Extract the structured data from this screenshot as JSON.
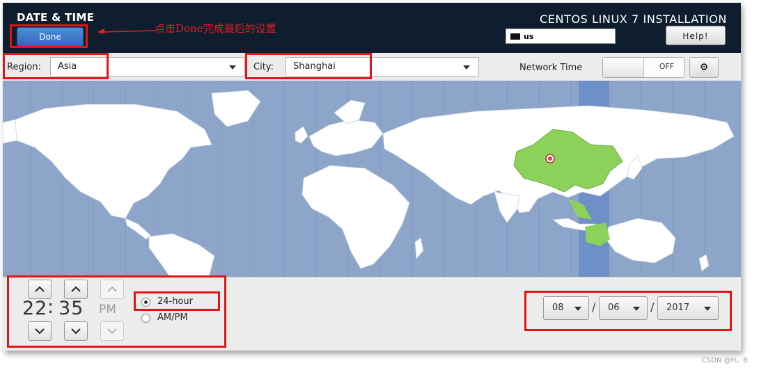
{
  "header": {
    "title": "DATE & TIME",
    "done_label": "Done",
    "product_title": "CENTOS LINUX 7 INSTALLATION",
    "keyboard_layout": "us",
    "help_label": "Help!"
  },
  "annotation": {
    "text": "点击Done完成最后的设置",
    "color": "#e02020"
  },
  "toolbar": {
    "region_label": "Region:",
    "region_value": "Asia",
    "city_label": "City:",
    "city_value": "Shanghai",
    "network_time_label": "Network Time",
    "network_time_state": "OFF",
    "settings_icon": "gear-icon"
  },
  "map": {
    "highlighted_zone_color": "#6f8fc7",
    "highlighted_country": "China",
    "country_highlight_color": "#8cd15a",
    "ocean_color": "#8da5c9",
    "marker_city": "Shanghai"
  },
  "time": {
    "hours": "22",
    "separator": ":",
    "minutes": "35",
    "ampm": "PM",
    "format_24h_label": "24-hour",
    "format_ampm_label": "AM/PM",
    "selected_format": "24-hour"
  },
  "date": {
    "month": "08",
    "day": "06",
    "year": "2017",
    "separator": "/"
  },
  "watermark": "CSDN @H。B",
  "colors": {
    "header_bg": "#0f1e2f",
    "done_button": "#2a6ab8",
    "highlight_box": "#e01515"
  }
}
